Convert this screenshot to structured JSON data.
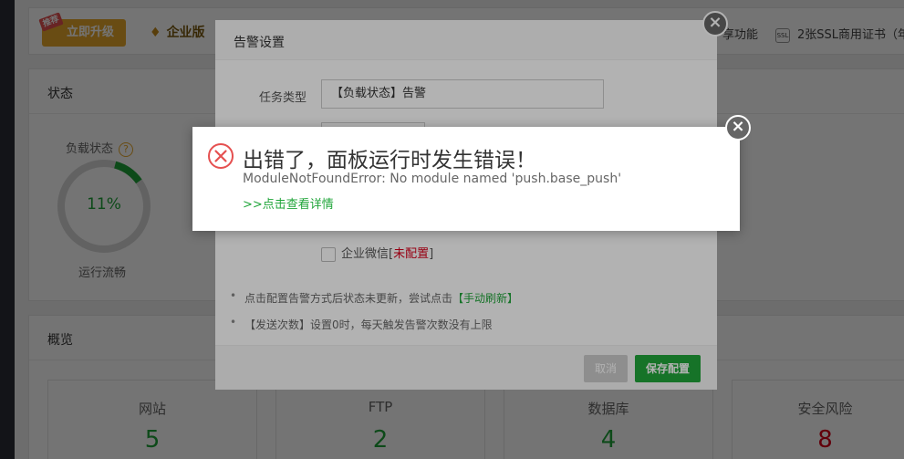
{
  "topbar": {
    "recommend_tag": "推荐",
    "upgrade_label": "立即升级",
    "enterprise_label": "企业版",
    "feature_partial": "享功能",
    "ssl_icon": "SSL",
    "ssl_label": "2张SSL商用证书（年"
  },
  "status": {
    "title": "状态",
    "load_label": "负载状态",
    "help": "?",
    "load_value": "11%",
    "load_fraction": 0.11,
    "load_status": "运行流畅"
  },
  "overview": {
    "title": "概览",
    "cards": [
      {
        "label": "网站",
        "value": "5"
      },
      {
        "label": "FTP",
        "value": "2"
      },
      {
        "label": "数据库",
        "value": "4"
      },
      {
        "label": "安全风险",
        "value": "8"
      }
    ]
  },
  "alert_dialog": {
    "title": "告警设置",
    "close": "×",
    "task_type_label": "任务类型",
    "task_type_value": "【负载状态】告警",
    "wechat_label": "企业微信",
    "wechat_status_open": "[",
    "wechat_status": "未配置",
    "wechat_status_close": "]",
    "tip1_text": "点击配置告警方式后状态未更新，尝试点击",
    "tip1_link": "【手动刷新】",
    "tip2_text": "【发送次数】设置0时，每天触发告警次数没有上限",
    "cancel_label": "取消",
    "save_label": "保存配置"
  },
  "error_popup": {
    "title": "出错了，面板运行时发生错误！",
    "detail": "ModuleNotFoundError: No module named 'push.base_push'",
    "link": ">>点击查看详情",
    "close": "×"
  },
  "colors": {
    "accent_green": "#20a53a",
    "danger_red": "#d9001b",
    "upgrade_gold": "#e8a92c"
  }
}
